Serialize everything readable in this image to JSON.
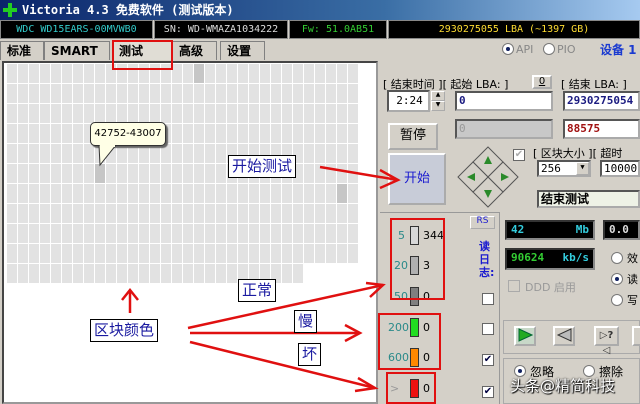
{
  "window": {
    "title": "Victoria 4.3 免费软件 (测试版本)"
  },
  "info": {
    "model": "WDC WD15EARS-00MVWB0",
    "serial": "SN: WD-WMAZA1034222",
    "firmware": "Fw: 51.0AB51",
    "capacity": "2930275055 LBA (~1397 GB)"
  },
  "tabs": [
    {
      "label": "标准"
    },
    {
      "label": "SMART"
    },
    {
      "label": "测试"
    },
    {
      "label": "高级"
    },
    {
      "label": "设置"
    }
  ],
  "mode": {
    "api": "API",
    "pio": "PIO",
    "device": "设备 1"
  },
  "grid": {
    "tooltip": "42752-43007"
  },
  "test": {
    "end_time_label": "[ 结束时间 ][ 起始 LBA: ]",
    "start_lba_reset": "0",
    "end_lba_label": "[ 结束 LBA: ]",
    "end_time": "2:24",
    "start_lba": "0",
    "end_lba": "2930275054",
    "current_lba": "0",
    "current_block": "88575",
    "pause": "暂停",
    "start": "开始",
    "block_size_label": "[ 区块大小 ][ 超时",
    "block_size": "256",
    "timeout": "10000",
    "end_action": "结束测试"
  },
  "legend": [
    {
      "ms": "5",
      "count": "344",
      "color": "#d8d8d8"
    },
    {
      "ms": "20",
      "count": "3",
      "color": "#b0b0b0"
    },
    {
      "ms": "50",
      "count": "0",
      "color": "#808080"
    },
    {
      "ms": "200",
      "count": "0",
      "color": "#22dd22"
    },
    {
      "ms": "600",
      "count": "0",
      "color": "#ff8800"
    },
    {
      "ms": ">",
      "count": "0",
      "color": "#ee1111"
    }
  ],
  "log": {
    "rs": "RS",
    "label": "读日志:"
  },
  "stats": {
    "mb": "42",
    "mb_unit": "Mb",
    "pct": "0.0",
    "speed": "90624",
    "speed_unit": "kb/s",
    "ddd": "DDD 启用",
    "modes": [
      "效",
      "读",
      "写"
    ]
  },
  "actions": {
    "ignore": "忽略",
    "erase": "擦除"
  },
  "annotations": {
    "start_test": "开始测试",
    "block_color": "区块颜色",
    "normal": "正常",
    "slow": "慢",
    "bad": "坏"
  },
  "watermark": "头条@精简科技"
}
